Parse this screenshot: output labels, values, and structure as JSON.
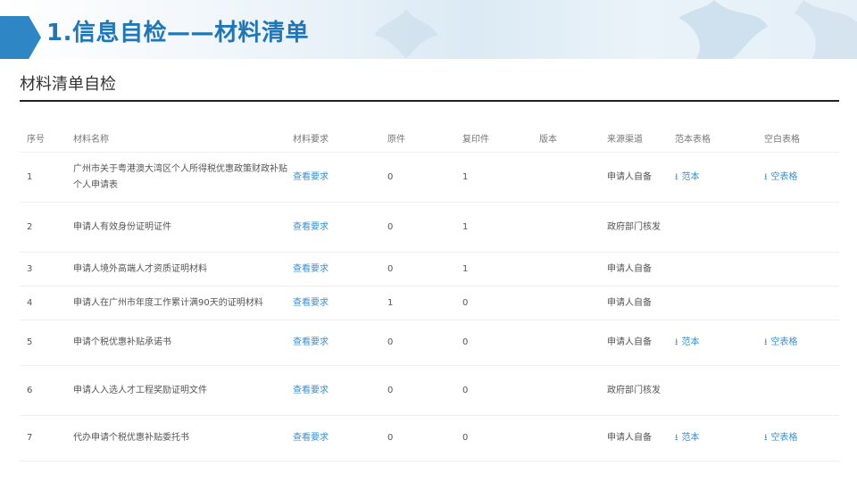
{
  "banner": {
    "title": "1.信息自检——材料清单",
    "accent_color": "#2f86c4",
    "title_color": "#1f77b8"
  },
  "section": {
    "title": "材料清单自检"
  },
  "table": {
    "headers": [
      "序号",
      "材料名称",
      "材料要求",
      "原件",
      "复印件",
      "版本",
      "来源渠道",
      "范本表格",
      "空白表格"
    ],
    "rows": [
      {
        "idx": "1",
        "name": "广州市关于粤港澳大湾区个人所得税优惠政策财政补贴个人申请表",
        "req": "查看要求",
        "orig": "0",
        "copy": "1",
        "version": "",
        "source": "申请人自备",
        "sample": "范本",
        "blank": "空表格"
      },
      {
        "idx": "2",
        "name": "申请人有效身份证明证件",
        "req": "查看要求",
        "orig": "0",
        "copy": "1",
        "version": "",
        "source": "政府部门核发",
        "sample": "",
        "blank": ""
      },
      {
        "idx": "3",
        "name": "申请人境外高端人才资质证明材料",
        "req": "查看要求",
        "orig": "0",
        "copy": "1",
        "version": "",
        "source": "申请人自备",
        "sample": "",
        "blank": ""
      },
      {
        "idx": "4",
        "name": "申请人在广州市年度工作累计满90天的证明材料",
        "req": "查看要求",
        "orig": "1",
        "copy": "0",
        "version": "",
        "source": "申请人自备",
        "sample": "",
        "blank": ""
      },
      {
        "idx": "5",
        "name": "申请个税优惠补贴承诺书",
        "req": "查看要求",
        "orig": "0",
        "copy": "0",
        "version": "",
        "source": "申请人自备",
        "sample": "范本",
        "blank": "空表格"
      },
      {
        "idx": "6",
        "name": "申请人入选人才工程奖励证明文件",
        "req": "查看要求",
        "orig": "0",
        "copy": "0",
        "version": "",
        "source": "政府部门核发",
        "sample": "",
        "blank": ""
      },
      {
        "idx": "7",
        "name": "代办申请个税优惠补贴委托书",
        "req": "查看要求",
        "orig": "0",
        "copy": "0",
        "version": "",
        "source": "申请人自备",
        "sample": "范本",
        "blank": "空表格"
      }
    ]
  },
  "icons": {
    "download": "download-icon"
  },
  "colors": {
    "link": "#3a8fd0",
    "rule": "#222222"
  }
}
